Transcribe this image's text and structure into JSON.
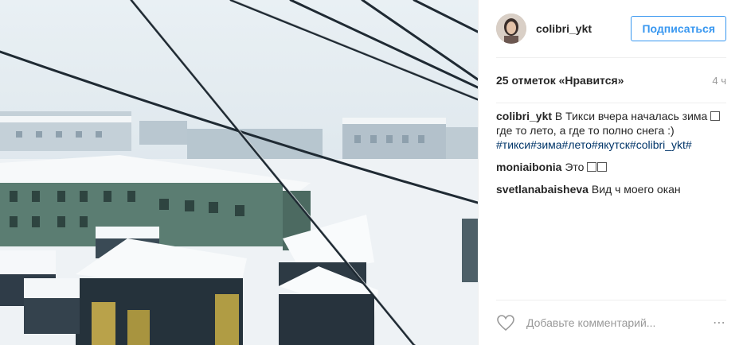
{
  "post": {
    "image_alt_icon": "snowy-town-photo",
    "author": {
      "username": "colibri_ykt",
      "avatar_icon": "avatar"
    },
    "follow_label": "Подписаться",
    "likes_text": "25 отметок «Нравится»",
    "time_ago": "4 ч",
    "comments": [
      {
        "user": "colibri_ykt",
        "text_before_emoji": "В Тикси вчера началась зима",
        "emoji_count": 1,
        "text_after_emoji": "где то лето, а где то полно снега :)",
        "hashtags": "#тикси#зима#лето#якутск#colibri_ykt#"
      },
      {
        "user": "moniaibonia",
        "text_before_emoji": "Это",
        "emoji_count": 2,
        "text_after_emoji": ""
      },
      {
        "user": "svetlanabaisheva",
        "text_before_emoji": "Вид ч моего окан",
        "emoji_count": 0,
        "text_after_emoji": ""
      }
    ],
    "comment_placeholder": "Добавьте комментарий...",
    "more_label": "⋯"
  },
  "colors": {
    "accent": "#3897f0",
    "hashtag": "#003569",
    "muted": "#999999"
  }
}
